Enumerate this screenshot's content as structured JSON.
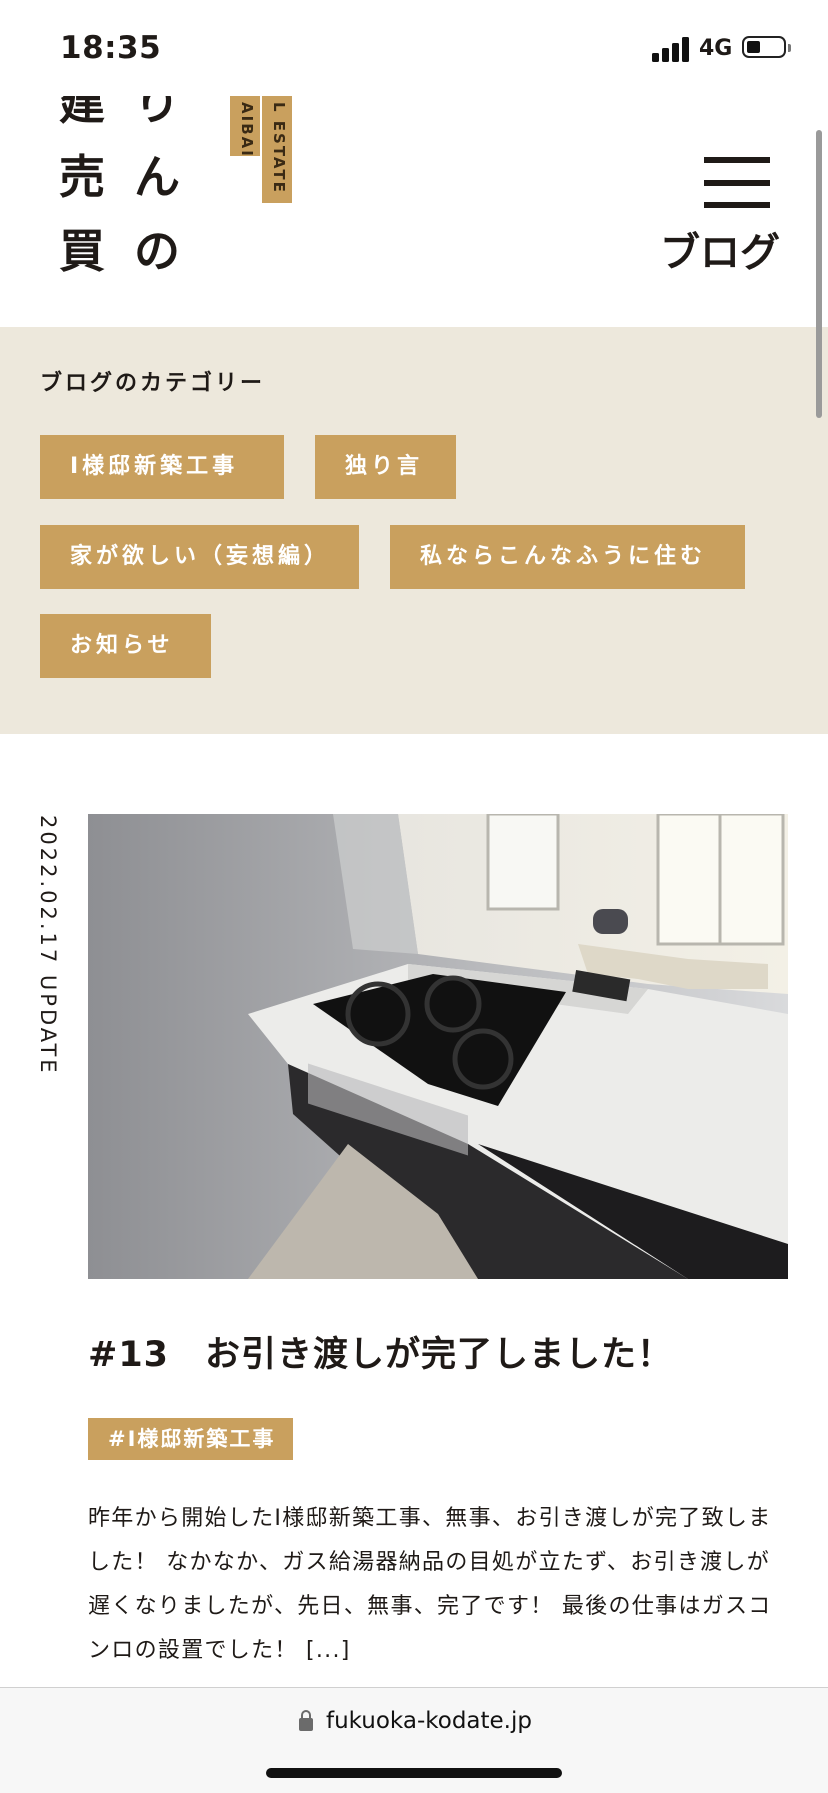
{
  "status_bar": {
    "time": "18:35",
    "network": "4G",
    "battery_level": 0.3
  },
  "header": {
    "logo_col1": [
      "建",
      "売",
      "買"
    ],
    "logo_col2": [
      "り",
      "ん",
      "の"
    ],
    "tag_short": "AIBAI",
    "tag_long": "L ESTATE",
    "menu_label": "ブログ"
  },
  "categories": {
    "title": "ブログのカテゴリー",
    "items": [
      "I様邸新築工事",
      "独り言",
      "家が欲しい（妄想編）",
      "私ならこんなふうに住む",
      "お知らせ"
    ]
  },
  "post": {
    "date": "2022.02.17 UPDATE",
    "title": "#13　お引き渡しが完了しました！",
    "tag": "#I様邸新築工事",
    "excerpt": "昨年から開始したI様邸新築工事、無事、お引き渡しが完了致しました！ なかなか、ガス給湯器納品の目処が立たず、お引き渡しが遅くなりましたが、先日、無事、完了です！ 最後の仕事はガスコンロの設置でした！ [...]"
  },
  "browser": {
    "url": "fukuoka-kodate.jp"
  },
  "colors": {
    "accent": "#c9a05e",
    "band": "#ede8dc",
    "text": "#1f1a17"
  }
}
